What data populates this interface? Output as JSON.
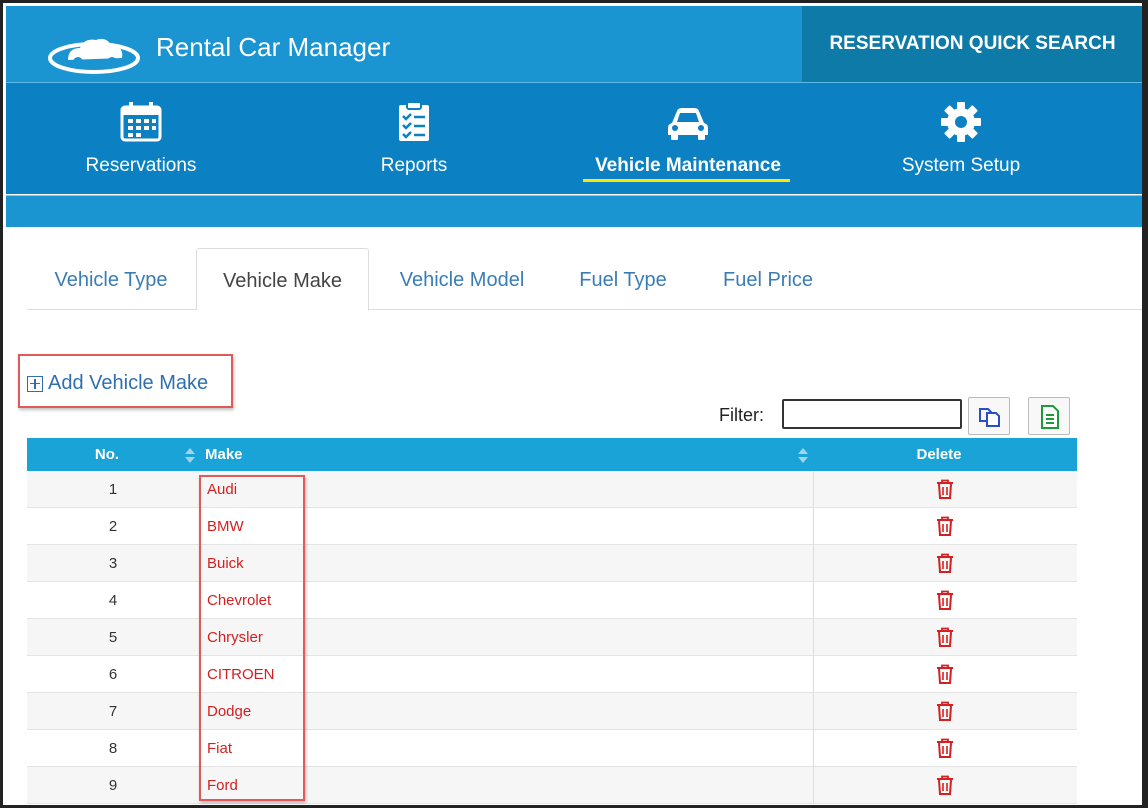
{
  "app": {
    "title": "Rental Car Manager",
    "quick_search_label": "RESERVATION QUICK SEARCH",
    "logo_icon": "cloud-car-logo"
  },
  "nav": {
    "items": [
      {
        "label": "Reservations",
        "icon": "calendar-icon"
      },
      {
        "label": "Reports",
        "icon": "clipboard-list-icon"
      },
      {
        "label": "Vehicle Maintenance",
        "icon": "car-icon",
        "active": true
      },
      {
        "label": "System Setup",
        "icon": "gear-icon"
      }
    ]
  },
  "tabs": [
    {
      "label": "Vehicle Type"
    },
    {
      "label": "Vehicle Make",
      "active": true
    },
    {
      "label": "Vehicle Model"
    },
    {
      "label": "Fuel Type"
    },
    {
      "label": "Fuel Price"
    }
  ],
  "actions": {
    "add_label": "Add Vehicle Make"
  },
  "filter": {
    "label": "Filter:",
    "value": ""
  },
  "table": {
    "columns": {
      "no": "No.",
      "make": "Make",
      "delete": "Delete"
    },
    "rows": [
      {
        "no": "1",
        "make": "Audi"
      },
      {
        "no": "2",
        "make": "BMW"
      },
      {
        "no": "3",
        "make": "Buick"
      },
      {
        "no": "4",
        "make": "Chevrolet"
      },
      {
        "no": "5",
        "make": "Chrysler"
      },
      {
        "no": "6",
        "make": "CITROEN"
      },
      {
        "no": "7",
        "make": "Dodge"
      },
      {
        "no": "8",
        "make": "Fiat"
      },
      {
        "no": "9",
        "make": "Ford"
      }
    ]
  },
  "colors": {
    "header_blue": "#1b94d2",
    "nav_blue": "#0b81c4",
    "quick_search_bg": "#0e7aa8",
    "active_underline": "#ffe600",
    "table_head": "#1aa3d6",
    "make_text": "#d42020",
    "highlight_box": "#e05a5a"
  }
}
